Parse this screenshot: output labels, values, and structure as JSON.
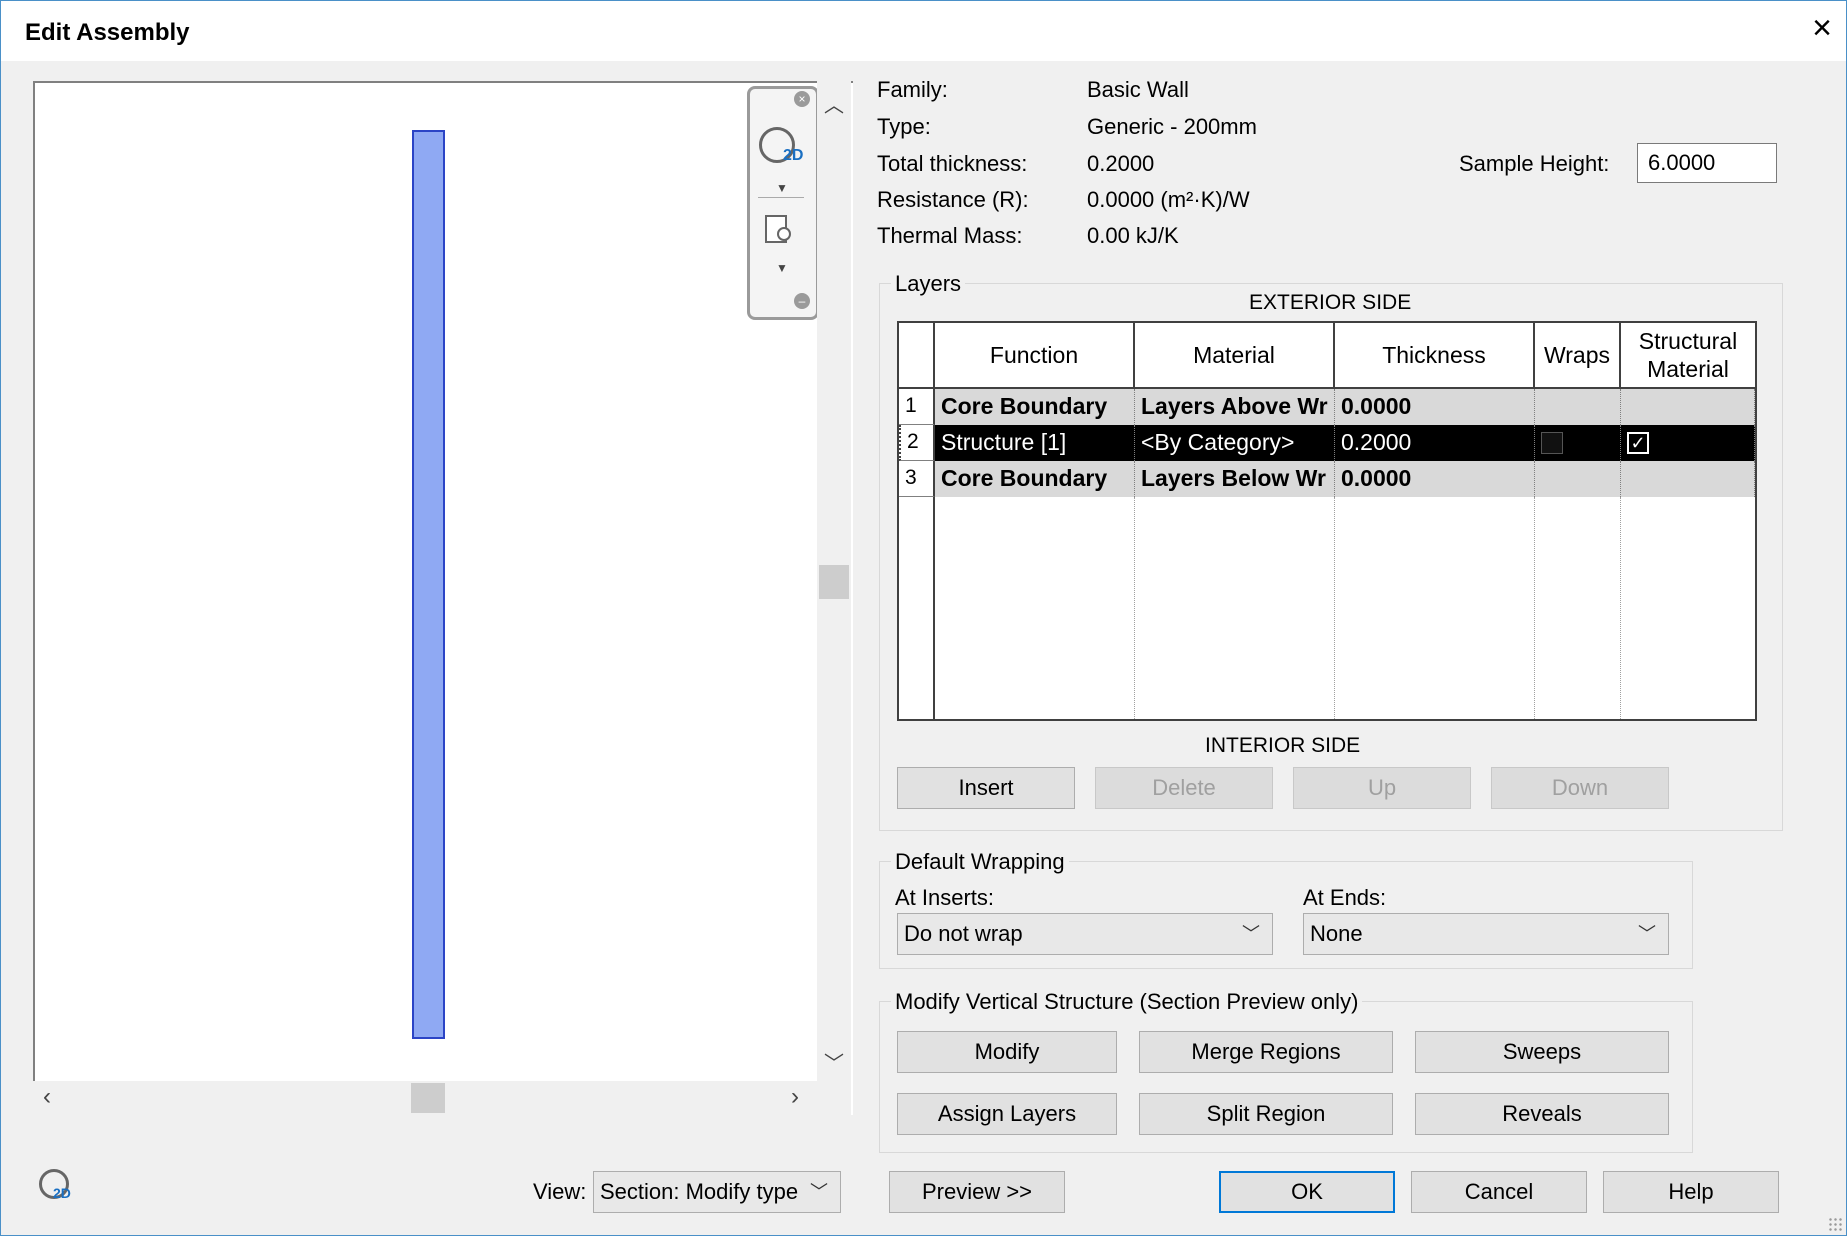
{
  "window": {
    "title": "Edit Assembly",
    "close_glyph": "×"
  },
  "info": {
    "family_label": "Family:",
    "family_value": "Basic Wall",
    "type_label": "Type:",
    "type_value": "Generic - 200mm",
    "thickness_label": "Total thickness:",
    "thickness_value": "0.2000",
    "resistance_label": "Resistance (R):",
    "resistance_value": "0.0000 (m²·K)/W",
    "thermal_label": "Thermal Mass:",
    "thermal_value": "0.00 kJ/K",
    "sample_height_label": "Sample Height:",
    "sample_height_value": "6.0000"
  },
  "layers": {
    "group_title": "Layers",
    "exterior_label": "EXTERIOR SIDE",
    "interior_label": "INTERIOR SIDE",
    "columns": [
      "Function",
      "Material",
      "Thickness",
      "Wraps",
      "Structural\nMaterial"
    ],
    "rows": [
      {
        "num": "1",
        "function": "Core Boundary",
        "material": "Layers Above Wr",
        "thickness": "0.0000",
        "style": "gray"
      },
      {
        "num": "2",
        "function": "Structure [1]",
        "material": "<By Category>",
        "thickness": "0.2000",
        "style": "selected",
        "wraps": false,
        "structural_material": true
      },
      {
        "num": "3",
        "function": "Core Boundary",
        "material": "Layers Below Wr",
        "thickness": "0.0000",
        "style": "gray"
      }
    ],
    "buttons": {
      "insert": "Insert",
      "delete": "Delete",
      "up": "Up",
      "down": "Down"
    }
  },
  "wrapping": {
    "group_title": "Default Wrapping",
    "at_inserts_label": "At Inserts:",
    "at_inserts_value": "Do not wrap",
    "at_ends_label": "At Ends:",
    "at_ends_value": "None"
  },
  "vertical": {
    "group_title": "Modify Vertical Structure (Section Preview only)",
    "modify": "Modify",
    "merge_regions": "Merge Regions",
    "sweeps": "Sweeps",
    "assign_layers": "Assign Layers",
    "split_region": "Split Region",
    "reveals": "Reveals"
  },
  "bottom": {
    "view_label": "View:",
    "view_value": "Section: Modify type",
    "preview": "Preview >>",
    "ok": "OK",
    "cancel": "Cancel",
    "help": "Help"
  },
  "nav": {
    "label_2d": "2D"
  },
  "colors": {
    "wall_fill": "#8fa9f3",
    "wall_stroke": "#2b44c6",
    "ok_border": "#0078d7"
  }
}
